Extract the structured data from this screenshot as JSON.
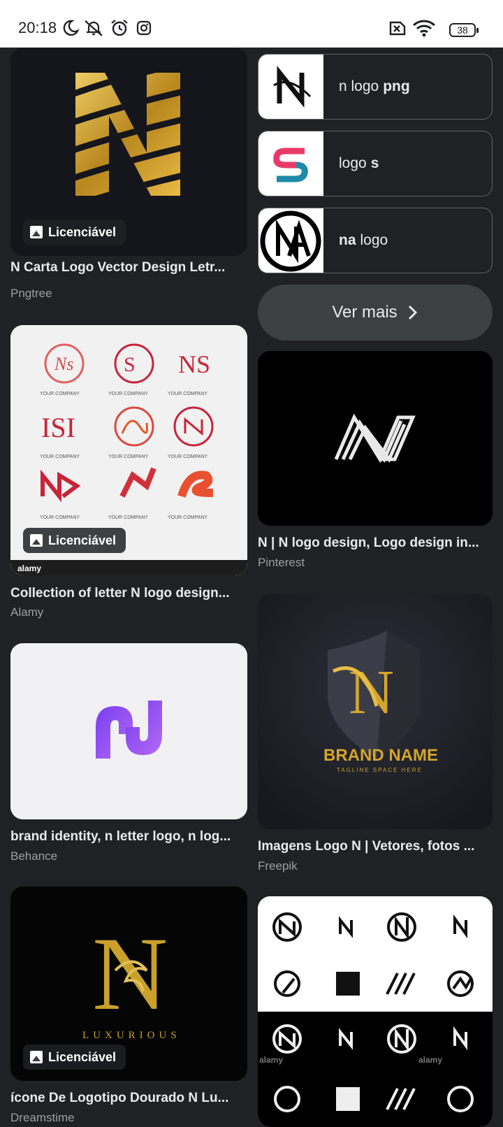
{
  "status_bar": {
    "time": "20:18",
    "icons": [
      "moon-icon",
      "bell-off-icon",
      "alarm-icon",
      "instagram-icon",
      "sim-off-icon",
      "wifi-icon"
    ],
    "battery": "38"
  },
  "left_column": [
    {
      "title": "N Carta Logo Vector Design Letr...",
      "source": "Pngtree",
      "badge": "Licenciável"
    },
    {
      "title": "Collection of letter N logo design...",
      "source": "Alamy",
      "badge": "Licenciável",
      "image_text": {
        "caption": "YOUR COMPANY",
        "footer": "alamy"
      }
    },
    {
      "title": "brand identity, n letter logo, n log...",
      "source": "Behance"
    },
    {
      "title": "ícone De Logotipo Dourado N Lu...",
      "source": "Dreamstime",
      "badge": "Licenciável",
      "image_text": {
        "word": "LUXURIOUS"
      }
    }
  ],
  "related_searches": [
    {
      "prefix": "n logo",
      "bold": "png"
    },
    {
      "prefix": "logo",
      "bold": "s"
    },
    {
      "bold": "na",
      "suffix": "logo"
    }
  ],
  "ver_mais": "Ver mais",
  "right_column": [
    {
      "title": "N | N logo design, Logo design in...",
      "source": "Pinterest"
    },
    {
      "title": "Imagens Logo N | Vetores, fotos ...",
      "source": "Freepik",
      "image_text": {
        "brand": "BRAND NAME",
        "tagline": "TAGLINE SPACE HERE"
      }
    },
    {
      "image_text": {
        "watermark": "alamy"
      }
    }
  ],
  "colors": {
    "background": "#202124",
    "chip_border": "#5f6368",
    "gold": "#c9a02c"
  }
}
